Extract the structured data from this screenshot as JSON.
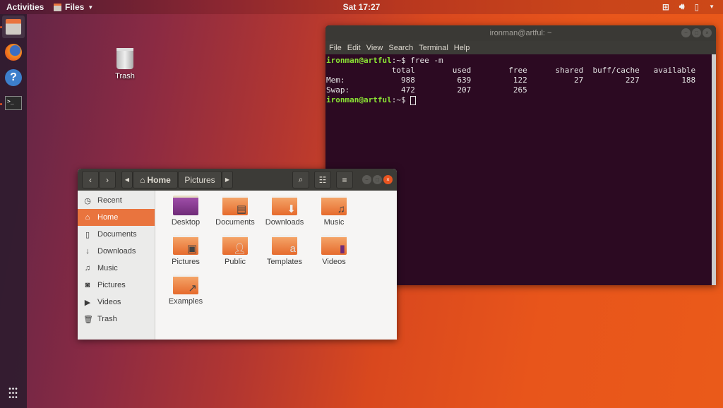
{
  "topbar": {
    "activities": "Activities",
    "app_menu": "Files",
    "clock": "Sat 17:27",
    "tray_icons": [
      "network-icon",
      "volume-icon",
      "battery-icon",
      "system-menu-caret-icon"
    ]
  },
  "dock": {
    "items": [
      {
        "name": "Files",
        "icon": "file-cabinet-icon",
        "running": true,
        "active": true
      },
      {
        "name": "Firefox",
        "icon": "firefox-icon",
        "running": false
      },
      {
        "name": "Help",
        "icon": "help-icon",
        "running": false
      },
      {
        "name": "Terminal",
        "icon": "terminal-icon",
        "running": true
      }
    ],
    "show_apps_icon": "grid-icon"
  },
  "desktop": {
    "icons": [
      {
        "label": "Trash",
        "icon": "trash-icon"
      }
    ]
  },
  "terminal": {
    "title": "ironman@artful: ~",
    "menu": [
      "File",
      "Edit",
      "View",
      "Search",
      "Terminal",
      "Help"
    ],
    "prompt": "ironman@artful",
    "prompt_suffix": ":~$ ",
    "command": "free -m",
    "header": "              total        used        free      shared  buff/cache   available",
    "rows": [
      "Mem:            988         639         122          27         227         188",
      "Swap:           472         207         265"
    ],
    "table": {
      "columns": [
        "total",
        "used",
        "free",
        "shared",
        "buff/cache",
        "available"
      ],
      "Mem": [
        988,
        639,
        122,
        27,
        227,
        188
      ],
      "Swap": [
        472,
        207,
        265
      ]
    }
  },
  "files": {
    "path": [
      "Home",
      "Pictures"
    ],
    "sidebar": [
      {
        "label": "Recent",
        "icon": "clock-icon"
      },
      {
        "label": "Home",
        "icon": "home-icon",
        "selected": true
      },
      {
        "label": "Documents",
        "icon": "document-icon"
      },
      {
        "label": "Downloads",
        "icon": "download-icon"
      },
      {
        "label": "Music",
        "icon": "music-icon"
      },
      {
        "label": "Pictures",
        "icon": "camera-icon"
      },
      {
        "label": "Videos",
        "icon": "video-icon"
      },
      {
        "label": "Trash",
        "icon": "trash-icon"
      }
    ],
    "items": [
      {
        "label": "Desktop"
      },
      {
        "label": "Documents"
      },
      {
        "label": "Downloads"
      },
      {
        "label": "Music"
      },
      {
        "label": "Pictures"
      },
      {
        "label": "Public"
      },
      {
        "label": "Templates"
      },
      {
        "label": "Videos"
      },
      {
        "label": "Examples"
      }
    ]
  }
}
